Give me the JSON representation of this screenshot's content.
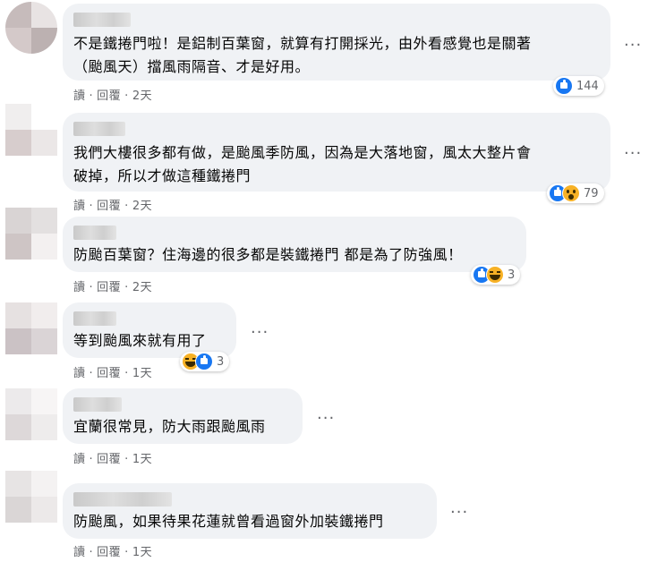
{
  "comments": [
    {
      "text": "不是鐵捲門啦！是鋁制百葉窗，就算有打開採光，由外看感覺也是關著\n（颱風天）擋風雨隔音、才是好用。",
      "actions": {
        "read": "讀",
        "reply": "回覆",
        "time": "2天"
      },
      "reactions": {
        "icons": [
          "like-icon"
        ],
        "count": "144"
      },
      "more": "···"
    },
    {
      "text": "我們大樓很多都有做，是颱風季防風，因為是大落地窗，風太大整片會\n破掉，所以才做這種鐵捲門",
      "actions": {
        "read": "讀",
        "reply": "回覆",
        "time": "2天"
      },
      "reactions": {
        "icons": [
          "like-icon",
          "wow-icon"
        ],
        "count": "79"
      },
      "more": "···"
    },
    {
      "text": "防颱百葉窗？住海邊的很多都是裝鐵捲門 都是為了防強風！",
      "actions": {
        "read": "讀",
        "reply": "回覆",
        "time": "2天"
      },
      "reactions": {
        "icons": [
          "like-icon",
          "haha-icon"
        ],
        "count": "3"
      },
      "more": ""
    },
    {
      "text": "等到颱風來就有用了",
      "actions": {
        "read": "讀",
        "reply": "回覆",
        "time": "1天"
      },
      "reactions": {
        "icons": [
          "haha-icon",
          "like-icon"
        ],
        "count": "3"
      },
      "more": "···"
    },
    {
      "text": "宜蘭很常見，防大雨跟颱風雨",
      "actions": {
        "read": "讀",
        "reply": "回覆",
        "time": "1天"
      },
      "reactions": null,
      "more": "···"
    },
    {
      "text": "防颱風，如果待果花蓮就曾看過窗外加裝鐵捲門",
      "actions": {
        "read": "讀",
        "reply": "回覆",
        "time": "1天"
      },
      "reactions": null,
      "more": "···"
    }
  ],
  "colors": {
    "bubble": "#f0f2f5",
    "like": "#1877f2",
    "secondary_text": "#65676b"
  }
}
